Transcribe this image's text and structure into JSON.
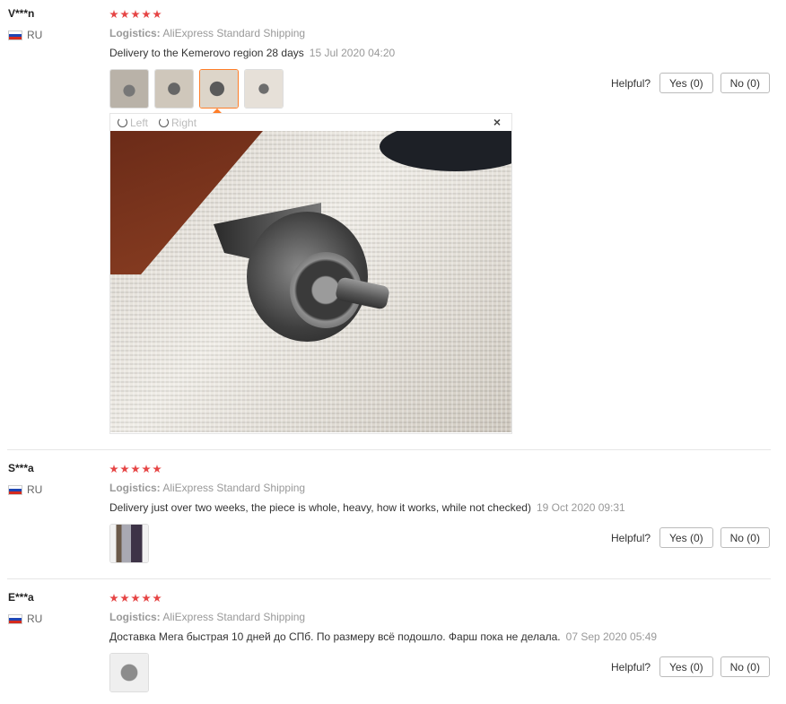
{
  "reviews": [
    {
      "buyer": "V***n",
      "country": "RU",
      "logistics_label": "Logistics:",
      "logistics_value": "AliExpress Standard Shipping",
      "text": "Delivery to the Kemerovo region 28 days",
      "date": "15 Jul 2020 04:20",
      "helpful_label": "Helpful?",
      "yes_label": "Yes (0)",
      "no_label": "No (0)"
    },
    {
      "buyer": "S***a",
      "country": "RU",
      "logistics_label": "Logistics:",
      "logistics_value": "AliExpress Standard Shipping",
      "text": "Delivery just over two weeks, the piece is whole, heavy, how it works, while not checked)",
      "date": "19 Oct 2020 09:31",
      "helpful_label": "Helpful?",
      "yes_label": "Yes (0)",
      "no_label": "No (0)"
    },
    {
      "buyer": "E***a",
      "country": "RU",
      "logistics_label": "Logistics:",
      "logistics_value": "AliExpress Standard Shipping",
      "text": "Доставка Мега быстрая 10 дней до СПб. По размеру всё подошло. Фарш пока не делала.",
      "date": "07 Sep 2020 05:49",
      "helpful_label": "Helpful?",
      "yes_label": "Yes (0)",
      "no_label": "No (0)"
    }
  ],
  "viewer": {
    "rotate_left_label": "Left",
    "rotate_right_label": "Right",
    "close_glyph": "×"
  },
  "colors": {
    "star": "#e64545",
    "active_thumb": "#ff7e29"
  },
  "rating": {
    "stars": 5,
    "max": 5
  }
}
